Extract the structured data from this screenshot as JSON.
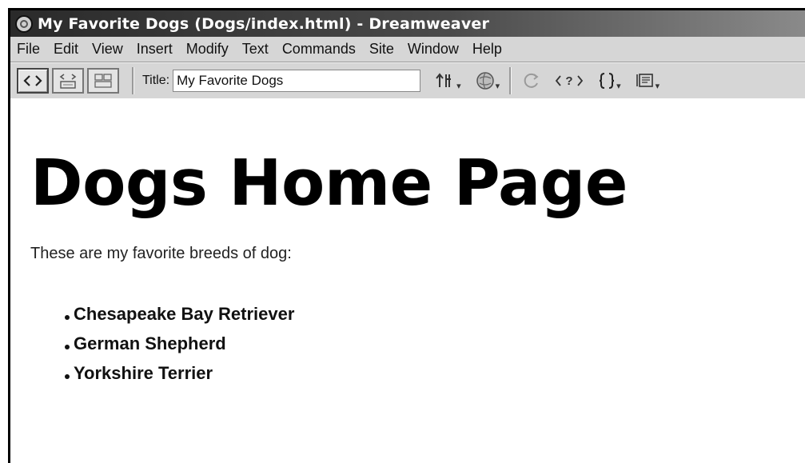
{
  "window": {
    "title": "My Favorite Dogs (Dogs/index.html) - Dreamweaver"
  },
  "menu": {
    "items": [
      "File",
      "Edit",
      "View",
      "Insert",
      "Modify",
      "Text",
      "Commands",
      "Site",
      "Window",
      "Help"
    ]
  },
  "toolbar": {
    "view_buttons": [
      "code-view-icon",
      "split-view-icon",
      "design-view-icon"
    ],
    "title_label": "Title:",
    "title_value": "My Favorite Dogs",
    "icons": [
      "file-management-icon",
      "preview-browser-icon",
      "refresh-icon",
      "code-nav-icon",
      "code-block-icon",
      "view-options-icon"
    ]
  },
  "document": {
    "heading": "Dogs Home Page",
    "intro": "These are my favorite breeds of dog:",
    "breeds": [
      "Chesapeake Bay Retriever",
      "German Shepherd",
      "Yorkshire Terrier"
    ]
  }
}
